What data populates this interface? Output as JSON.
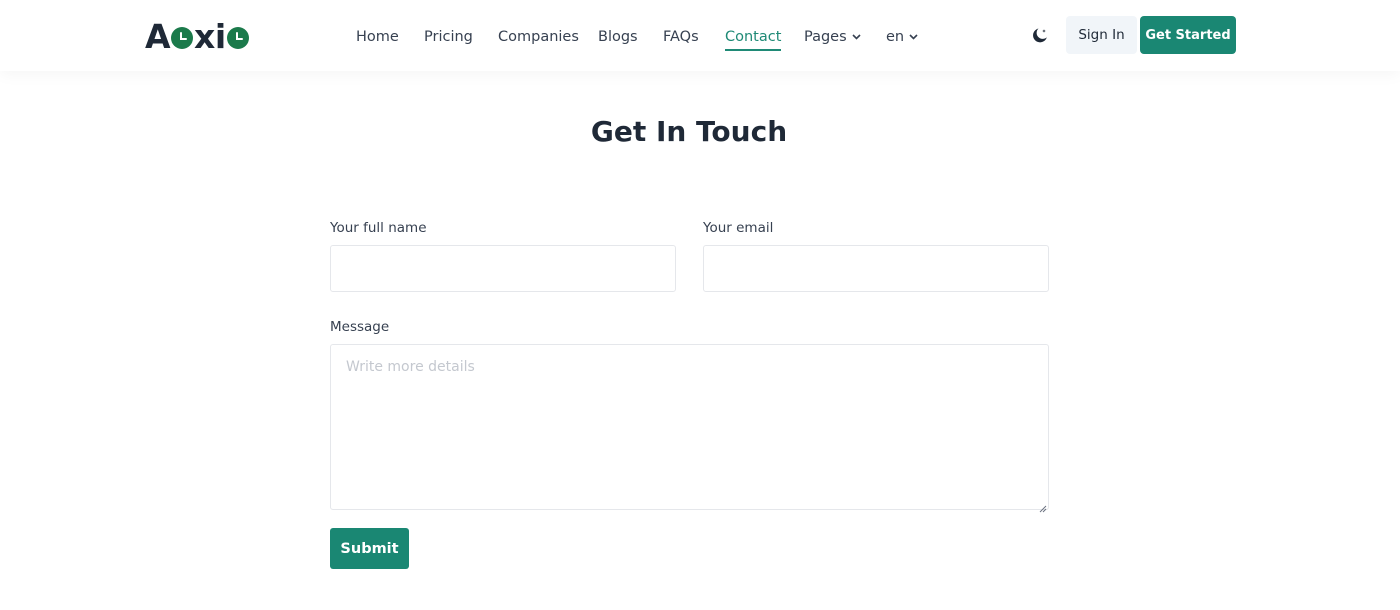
{
  "brand": {
    "logo_parts": [
      "A",
      "xi"
    ],
    "logo_icon": "clock-icon",
    "logo_accent_color": "#1b7a4b"
  },
  "nav": {
    "items": [
      {
        "label": "Home"
      },
      {
        "label": "Pricing"
      },
      {
        "label": "Companies"
      },
      {
        "label": "Blogs"
      },
      {
        "label": "FAQs"
      },
      {
        "label": "Contact",
        "active": true
      },
      {
        "label": "Pages",
        "dropdown": true
      },
      {
        "label": "en",
        "dropdown": true
      }
    ],
    "active_color": "#1f8a76"
  },
  "header_actions": {
    "theme_icon": "moon-icon",
    "sign_in_label": "Sign In",
    "get_started_label": "Get Started",
    "primary_color": "#1a8773"
  },
  "page": {
    "title": "Get In Touch"
  },
  "form": {
    "full_name": {
      "label": "Your full name",
      "value": "",
      "placeholder": ""
    },
    "email": {
      "label": "Your email",
      "value": "",
      "placeholder": ""
    },
    "message": {
      "label": "Message",
      "value": "",
      "placeholder": "Write more details"
    },
    "submit_label": "Submit"
  }
}
